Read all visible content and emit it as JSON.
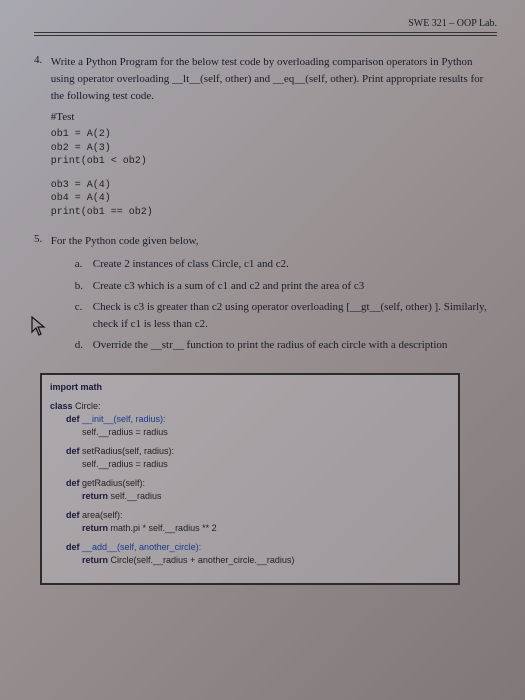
{
  "header": {
    "course": "SWE 321 – OOP Lab."
  },
  "q4": {
    "number": "4.",
    "prompt": "Write a Python Program for the below test code by overloading comparison operators in Python using operator overloading __lt__(self, other) and __eq__(self, other). Print appropriate results for the following test code.",
    "test_label": "#Test",
    "code1": "ob1 = A(2)\nob2 = A(3)\nprint(ob1 < ob2)",
    "code2": "ob3 = A(4)\nob4 = A(4)\nprint(ob1 == ob2)"
  },
  "q5": {
    "number": "5.",
    "prompt": "For the Python code given below,",
    "items": {
      "a": "Create 2 instances of class Circle, c1 and c2.",
      "b": "Create c3 which is a sum of c1 and c2 and print the area of c3",
      "c": "Check is c3 is greater than c2 using operator overloading [__gt__(self, other) ]. Similarly, check if c1 is less than c2.",
      "d": "Override the __str__ function to print the radius of each circle with a description"
    }
  },
  "pycode": {
    "l0": "import math",
    "l1": "class Circle:",
    "l2": "def __init__(self, radius):",
    "l3": "self.__radius = radius",
    "l4": "def setRadius(self, radius):",
    "l5": "self.__radius = radius",
    "l6": "def getRadius(self):",
    "l7": "return self.__radius",
    "l8": "def area(self):",
    "l9": "return math.pi * self.__radius ** 2",
    "l10": "def __add__(self, another_circle):",
    "l11": "return Circle(self.__radius + another_circle.__radius)"
  }
}
